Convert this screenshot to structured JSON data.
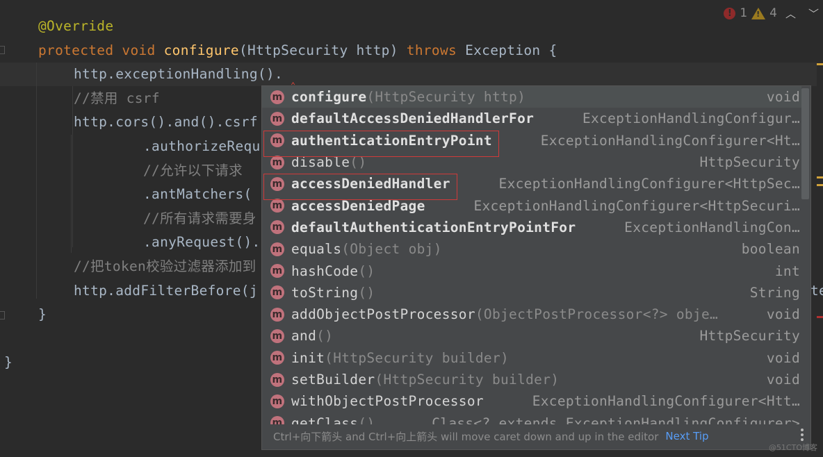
{
  "editor": {
    "lines": [
      {
        "indent": 0,
        "parts": [
          {
            "t": "@Override",
            "c": "ann"
          }
        ]
      },
      {
        "indent": 0,
        "parts": [
          {
            "t": "protected ",
            "c": "kw"
          },
          {
            "t": "void ",
            "c": "kw"
          },
          {
            "t": "configure",
            "c": "fn"
          },
          {
            "t": "(HttpSecurity http) ",
            "c": "plain"
          },
          {
            "t": "throws ",
            "c": "kw"
          },
          {
            "t": "Exception {",
            "c": "plain"
          }
        ]
      },
      {
        "indent": 1,
        "parts": [
          {
            "t": "http.exceptionHandling().",
            "c": "plain"
          }
        ]
      },
      {
        "indent": 1,
        "parts": [
          {
            "t": "//禁用 csrf",
            "c": "cm"
          }
        ]
      },
      {
        "indent": 1,
        "parts": [
          {
            "t": "http.cors().and().csrf",
            "c": "plain"
          }
        ]
      },
      {
        "indent": 3,
        "parts": [
          {
            "t": ".authorizeRequ",
            "c": "plain"
          }
        ]
      },
      {
        "indent": 3,
        "parts": [
          {
            "t": "//允许以下请求",
            "c": "cm"
          }
        ]
      },
      {
        "indent": 3,
        "parts": [
          {
            "t": ".antMatchers(",
            "c": "plain"
          }
        ]
      },
      {
        "indent": 3,
        "parts": [
          {
            "t": "//所有请求需要身",
            "c": "cm"
          }
        ]
      },
      {
        "indent": 3,
        "parts": [
          {
            "t": ".anyRequest().",
            "c": "plain"
          }
        ]
      },
      {
        "indent": 1,
        "parts": [
          {
            "t": "//把token校验过滤器添加到",
            "c": "cm"
          }
        ]
      },
      {
        "indent": 1,
        "parts": [
          {
            "t": "http.addFilterBefore(j",
            "c": "plain"
          }
        ]
      },
      {
        "indent": 0,
        "parts": [
          {
            "t": "}",
            "c": "plain"
          }
        ]
      },
      {
        "indent": 0,
        "parts": [
          {
            "t": "",
            "c": "plain"
          }
        ]
      },
      {
        "indent": -1,
        "parts": [
          {
            "t": "}",
            "c": "plain"
          }
        ]
      }
    ],
    "overflow_text": "te"
  },
  "status": {
    "errors": "1",
    "warnings": "4",
    "prev_icon": "chevron-up-icon",
    "next_icon": "chevron-down-icon"
  },
  "completion": {
    "icon_letter": "m",
    "items": [
      {
        "name": "configure",
        "params": "(HttpSecurity http)",
        "type": "void",
        "bold": true,
        "selected": true
      },
      {
        "name": "defaultAccessDeniedHandlerFor",
        "params": "",
        "type": "ExceptionHandlingConfigur…",
        "bold": true
      },
      {
        "name": "authenticationEntryPoint",
        "params": "",
        "type": "ExceptionHandlingConfigurer<Ht…",
        "bold": true,
        "highlighted": true
      },
      {
        "name": "disable",
        "params": "()",
        "type": "HttpSecurity",
        "bold": false
      },
      {
        "name": "accessDeniedHandler",
        "params": "",
        "type": "ExceptionHandlingConfigurer<HttpSec…",
        "bold": true,
        "highlighted": true
      },
      {
        "name": "accessDeniedPage",
        "params": "",
        "type": "ExceptionHandlingConfigurer<HttpSecuri…",
        "bold": true
      },
      {
        "name": "defaultAuthenticationEntryPointFor",
        "params": "",
        "type": "ExceptionHandlingCon…",
        "bold": true
      },
      {
        "name": "equals",
        "params": "(Object obj)",
        "type": "boolean",
        "bold": false
      },
      {
        "name": "hashCode",
        "params": "()",
        "type": "int",
        "bold": false
      },
      {
        "name": "toString",
        "params": "()",
        "type": "String",
        "bold": false
      },
      {
        "name": "addObjectPostProcessor",
        "params": "(ObjectPostProcessor<?> obje…",
        "type": "void",
        "bold": false
      },
      {
        "name": "and",
        "params": "()",
        "type": "HttpSecurity",
        "bold": false
      },
      {
        "name": "init",
        "params": "(HttpSecurity builder)",
        "type": "void",
        "bold": false
      },
      {
        "name": "setBuilder",
        "params": "(HttpSecurity builder)",
        "type": "void",
        "bold": false
      },
      {
        "name": "withObjectPostProcessor",
        "params": "",
        "type": "ExceptionHandlingConfigurer<Htt…",
        "bold": false
      },
      {
        "name": "getClass",
        "params": "()",
        "type": "Class<? extends ExceptionHandlingConfigurer>",
        "bold": false
      }
    ],
    "footer_text": "Ctrl+向下箭头 and Ctrl+向上箭头 will move caret down and up in the editor",
    "next_tip_label": "Next Tip"
  },
  "watermark": "@51CTO博客"
}
